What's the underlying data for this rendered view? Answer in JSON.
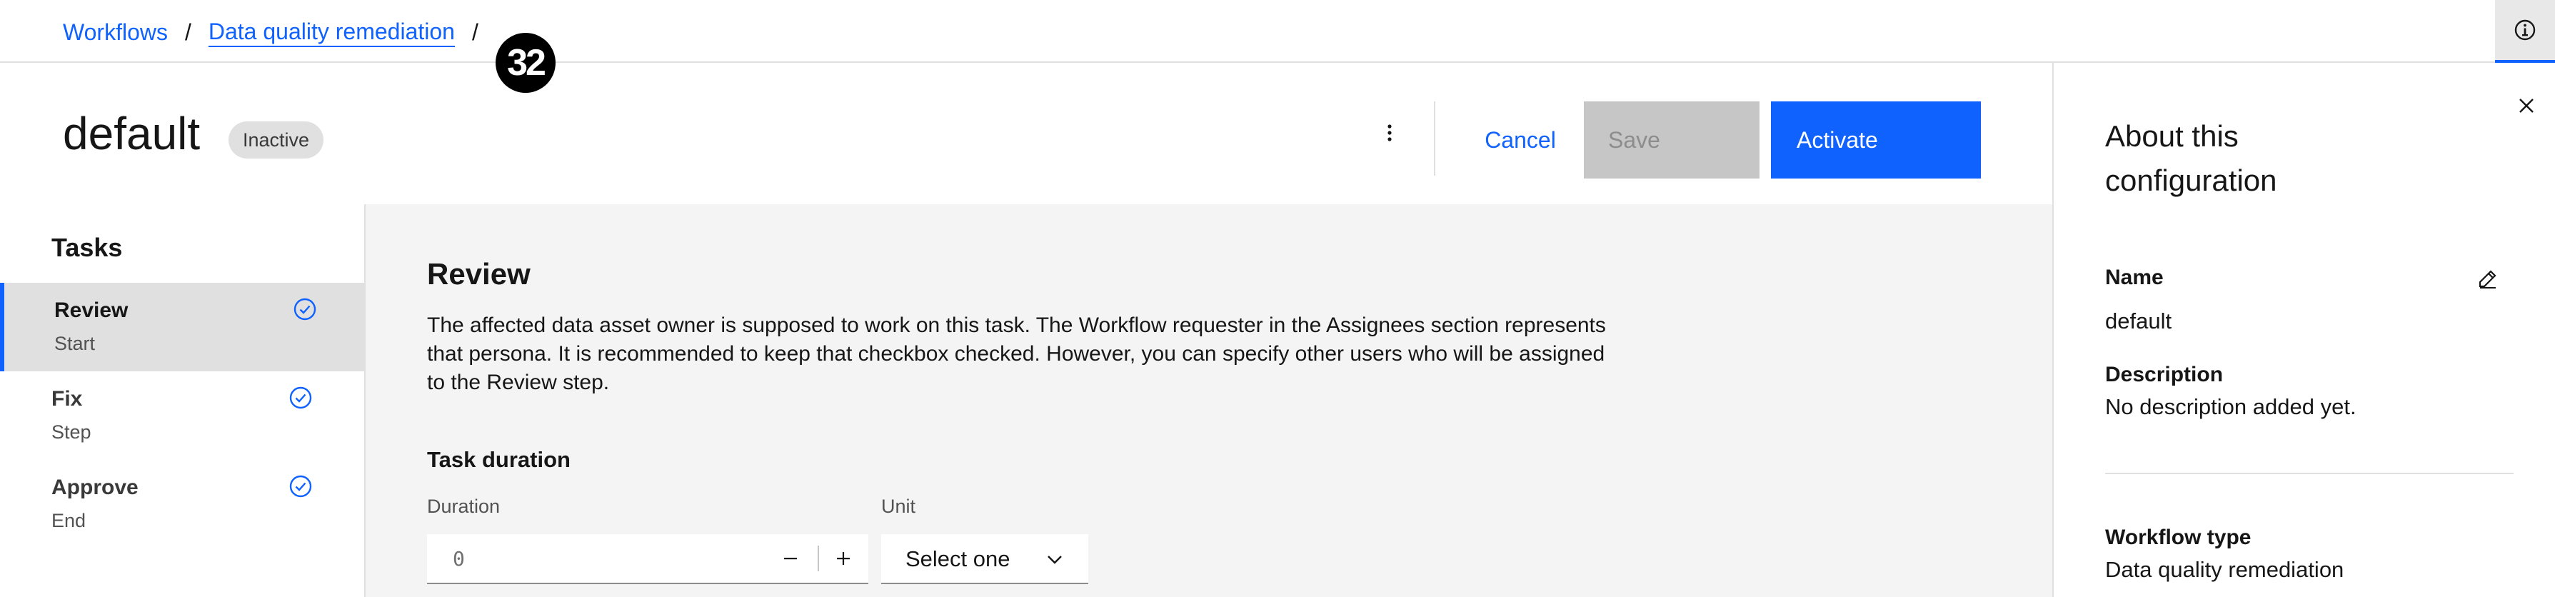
{
  "breadcrumb": {
    "items": [
      "Workflows",
      "Data quality remediation"
    ],
    "separator": "/"
  },
  "step_badge": "32",
  "header": {
    "title": "default",
    "status": "Inactive",
    "cancel_label": "Cancel",
    "save_label": "Save",
    "activate_label": "Activate"
  },
  "tasks": {
    "heading": "Tasks",
    "items": [
      {
        "name": "Review",
        "type": "Start",
        "selected": true
      },
      {
        "name": "Fix",
        "type": "Step",
        "selected": false
      },
      {
        "name": "Approve",
        "type": "End",
        "selected": false
      }
    ]
  },
  "main": {
    "title": "Review",
    "description": "The affected data asset owner is supposed to work on this task. The Workflow requester in the Assignees section represents that persona. It is recommended to keep that checkbox checked. However, you can specify other users who will be assigned to the Review step.",
    "duration_heading": "Task duration",
    "duration_label": "Duration",
    "duration_value": "0",
    "unit_label": "Unit",
    "unit_placeholder": "Select one"
  },
  "about": {
    "title": "About this configuration",
    "name_label": "Name",
    "name_value": "default",
    "description_label": "Description",
    "description_value": "No description added yet.",
    "workflow_type_label": "Workflow type",
    "workflow_type_value": "Data quality remediation"
  },
  "colors": {
    "accent": "#0f62fe",
    "disabled_bg": "#c6c6c6",
    "content_bg": "#f4f4f4",
    "selected_bg": "#e0e0e0"
  }
}
